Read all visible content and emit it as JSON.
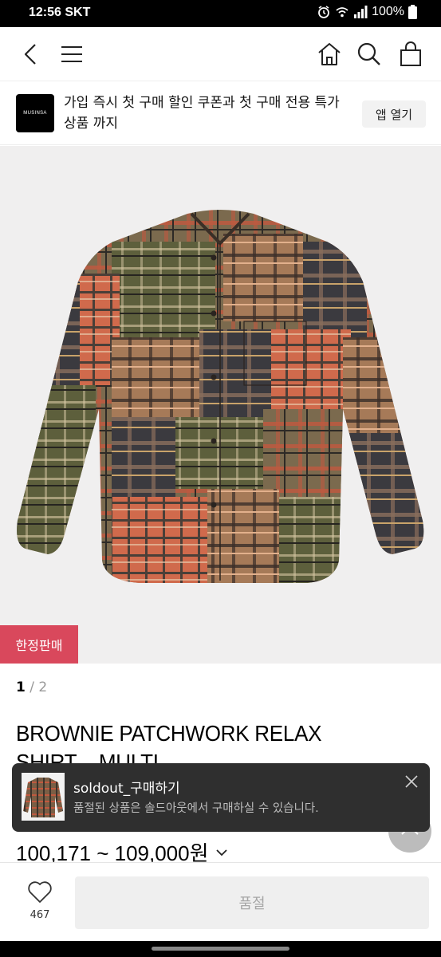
{
  "status_bar": {
    "time": "12:56",
    "carrier": "SKT",
    "battery": "100%"
  },
  "nav": {
    "back_icon": "chevron-left-icon",
    "menu_icon": "hamburger-icon",
    "home_icon": "home-icon",
    "search_icon": "search-icon",
    "cart_icon": "shopping-bag-icon"
  },
  "banner": {
    "logo_text": "MUSINSA",
    "text": "가입 즉시 첫 구매 할인 쿠폰과 첫 구매 전용 특가 상품 까지",
    "button": "앱 열기"
  },
  "product": {
    "badge": "한정판매",
    "page_current": "1",
    "page_separator": "/",
    "page_total": "2",
    "title": "BROWNIE PATCHWORK RELAX SHIRT _ MULTI",
    "price": "100,171 ~ 109,000원"
  },
  "toast": {
    "title": "soldout_구매하기",
    "subtitle": "품절된 상품은 솔드아웃에서 구매하실 수 있습니다."
  },
  "bottom": {
    "like_count": "467",
    "soldout_label": "품절"
  },
  "colors": {
    "badge": "#d9485c",
    "toast_bg": "#2f2f2f"
  }
}
